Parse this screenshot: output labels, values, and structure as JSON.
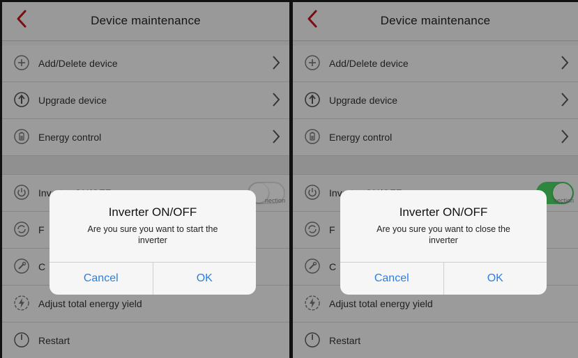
{
  "panels": [
    {
      "nav": {
        "title": "Device maintenance"
      },
      "rows": {
        "add_delete": "Add/Delete device",
        "upgrade": "Upgrade device",
        "energy_control": "Energy control",
        "inverter": "Inverter ON/OFF",
        "inverter_sub": "nection",
        "row5_label": "F",
        "row6_label": "C",
        "adjust_yield": "Adjust total energy yield",
        "restart": "Restart"
      },
      "toggle_state": "off",
      "dialog": {
        "title": "Inverter ON/OFF",
        "message": "Are you sure you want to start the inverter",
        "cancel": "Cancel",
        "ok": "OK"
      }
    },
    {
      "nav": {
        "title": "Device maintenance"
      },
      "rows": {
        "add_delete": "Add/Delete device",
        "upgrade": "Upgrade device",
        "energy_control": "Energy control",
        "inverter": "Inverter ON/OFF",
        "inverter_sub": "nection",
        "row5_label": "F",
        "row6_label": "C",
        "adjust_yield": "Adjust total energy yield",
        "restart": "Restart"
      },
      "toggle_state": "on",
      "dialog": {
        "title": "Inverter ON/OFF",
        "message": "Are you sure you want to close the inverter",
        "cancel": "Cancel",
        "ok": "OK"
      }
    }
  ],
  "colors": {
    "accent_back": "#c5161d",
    "dialog_button": "#2a7fe6",
    "toggle_on": "#4cd964"
  }
}
